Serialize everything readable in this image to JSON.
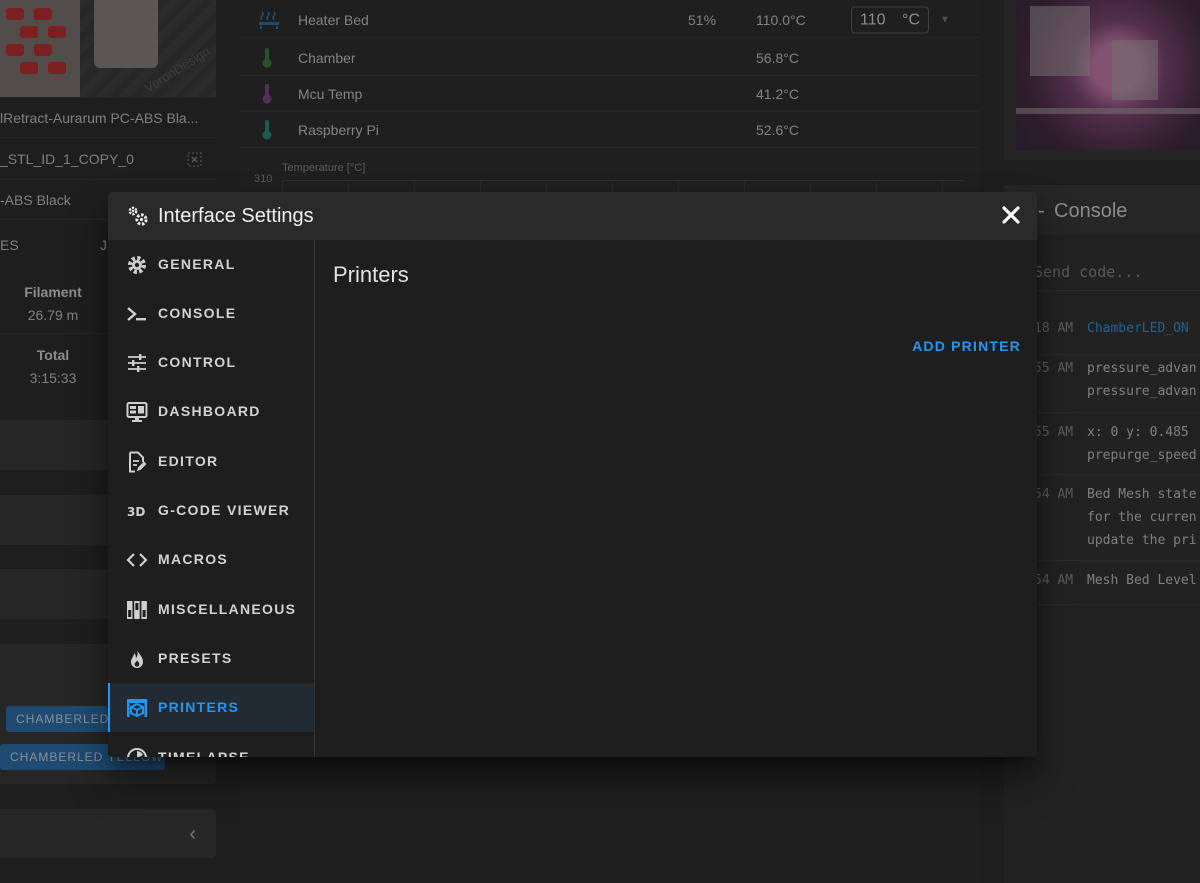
{
  "left_panel": {
    "file_name": "lRetract-Aurarum PC-ABS Bla...",
    "object_id": "_STL_ID_1_COPY_0",
    "filament_name": "-ABS Black",
    "row_cut_left": "ES",
    "row_cut_right": "J",
    "thumbnail_logo": "VoronDesign",
    "filament_label": "Filament",
    "filament_value": "26.79 m",
    "total_label": "Total",
    "total_value": "3:15:33",
    "macro_buttons": [
      "CHAMBERLED_ON",
      "CHAMBERLED YELLOW"
    ]
  },
  "temperatures": {
    "rows": [
      {
        "name": "Heater Bed",
        "power": "51%",
        "current": "110.0°C",
        "target": "110",
        "unit": "°C"
      },
      {
        "name": "Chamber",
        "power": "",
        "current": "56.8°C"
      },
      {
        "name": "Mcu Temp",
        "power": "",
        "current": "41.2°C"
      },
      {
        "name": "Raspberry Pi",
        "power": "",
        "current": "52.6°C"
      }
    ],
    "chart_label": "Temperature [°C]",
    "chart_top_tick": "310"
  },
  "console": {
    "title": "Console",
    "input_placeholder": "Send code...",
    "entries": [
      {
        "time": "18 AM",
        "message": "ChamberLED_ON"
      },
      {
        "time": "55 AM",
        "message": "pressure_advan\npressure_advan"
      },
      {
        "time": "55 AM",
        "message": "x: 0 y: 0.485\nprepurge_speed"
      },
      {
        "time": "54 AM",
        "message": "Bed Mesh state\nfor the curren\nupdate the pri"
      },
      {
        "time": "54 AM",
        "message": "Mesh Bed Level"
      }
    ]
  },
  "dialog": {
    "title": "Interface Settings",
    "nav": [
      {
        "label": "GENERAL",
        "icon": "cog-icon"
      },
      {
        "label": "CONSOLE",
        "icon": "console-icon"
      },
      {
        "label": "CONTROL",
        "icon": "sliders-icon"
      },
      {
        "label": "DASHBOARD",
        "icon": "monitor-dashboard-icon"
      },
      {
        "label": "EDITOR",
        "icon": "file-edit-icon"
      },
      {
        "label": "G-CODE VIEWER",
        "icon": "3d-icon"
      },
      {
        "label": "MACROS",
        "icon": "code-tags-icon"
      },
      {
        "label": "MISCELLANEOUS",
        "icon": "dip-switch-icon"
      },
      {
        "label": "PRESETS",
        "icon": "fire-icon"
      },
      {
        "label": "PRINTERS",
        "icon": "printer-3d-icon"
      },
      {
        "label": "TIMELAPSE",
        "icon": "timelapse-icon"
      }
    ],
    "active_nav": "PRINTERS",
    "content_title": "Printers",
    "add_printer_label": "ADD PRINTER"
  },
  "colors": {
    "accent": "#2196f3",
    "dialog_bg": "#1e1e1e",
    "header_bg": "#2a2a2a"
  }
}
